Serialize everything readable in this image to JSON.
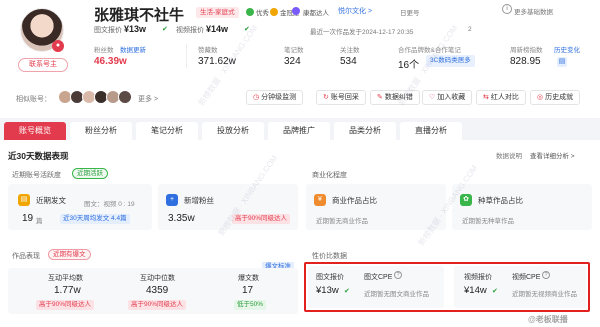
{
  "profile": {
    "name": "张雅琪不社牛",
    "category": "生活-家庭式",
    "flags": [
      {
        "label": "优秀",
        "color": "#39b54a"
      },
      {
        "label": "金冠屋",
        "color": "#f0a500"
      },
      {
        "label": "康都达人",
        "color": "#7a5af8"
      }
    ],
    "company": "悦尔文化 >",
    "day_tag": "日更号",
    "more_info": "更多基础数据",
    "contact_button": "联系号主",
    "image_price_label": "图文报价",
    "image_price": "¥13w",
    "video_price_label": "视频报价",
    "video_price": "¥14w",
    "last_update": "最近一次作品发于2024-12-17 20:35",
    "dept": "2",
    "related_label": "相似账号：",
    "related_more": "更多 >"
  },
  "metrics": [
    {
      "label": "粉丝数",
      "value": "46.39w",
      "extra": "数据更新"
    },
    {
      "label": "赞藏数",
      "value": "371.62w"
    },
    {
      "label": "笔记数",
      "value": "324"
    },
    {
      "label": "关注数",
      "value": "534"
    },
    {
      "label": "合作品牌数&合作笔记",
      "value": "16个",
      "badge": "3C数码类居多"
    },
    {
      "label": "周新榜指数",
      "value": "828.95",
      "extra": "历史变化"
    }
  ],
  "actions": [
    "分钟级监测",
    "账号回采",
    "数据纠错",
    "加入收藏",
    "红人对比",
    "历史成就"
  ],
  "tabs": [
    "账号概览",
    "粉丝分析",
    "笔记分析",
    "投放分析",
    "品牌推广",
    "品类分析",
    "直播分析"
  ],
  "overview": {
    "title": "近30天数据表现",
    "help": "数据说明",
    "more": "查看详细分析 >",
    "activity_title": "近期账号活跃度",
    "activity_badge": "近期活跃",
    "commercial_title": "商业化程度",
    "recent_post_label": "近期发文",
    "recent_post_value": "19",
    "recent_post_unit": "篇",
    "recent_post_detail": "图文：视频 0 : 19",
    "recent_post_pill": "近30天周均发文 4.4篇",
    "new_fans_label": "新增粉丝",
    "new_fans_value": "3.35w",
    "new_fans_pill": "高于90%同级达人",
    "biz_label": "商业作品占比",
    "biz_note": "近期暂无商业作品",
    "seed_label": "种草作品占比",
    "seed_note": "近期暂无种草作品",
    "perf_title": "作品表现",
    "perf_badge": "近期有爆文",
    "perf_help": "爆文标准",
    "perf_items": [
      {
        "label": "互动平均数",
        "value": "1.77w",
        "pill": "高于90%同级达人"
      },
      {
        "label": "互动中位数",
        "value": "4359",
        "pill": "高于90%同级达人"
      },
      {
        "label": "爆文数",
        "value": "17",
        "pill": "低于50%"
      }
    ],
    "value_title": "性价比数据",
    "cpe_items": [
      {
        "price_label": "图文报价",
        "price": "¥13w",
        "cpe_label": "图文CPE",
        "note": "近期暂无图文商业作品"
      },
      {
        "price_label": "视频报价",
        "price": "¥14w",
        "cpe_label": "视频CPE",
        "note": "近期暂无视频商业作品"
      }
    ]
  },
  "watermark": "新榜数据 · XINBANG.COM",
  "corner_mark": "@老板联播",
  "colors": {
    "accent": "#e23b4d",
    "link": "#2f6fe0",
    "positive": "#39b54a",
    "highlight_border": "#e32020"
  }
}
